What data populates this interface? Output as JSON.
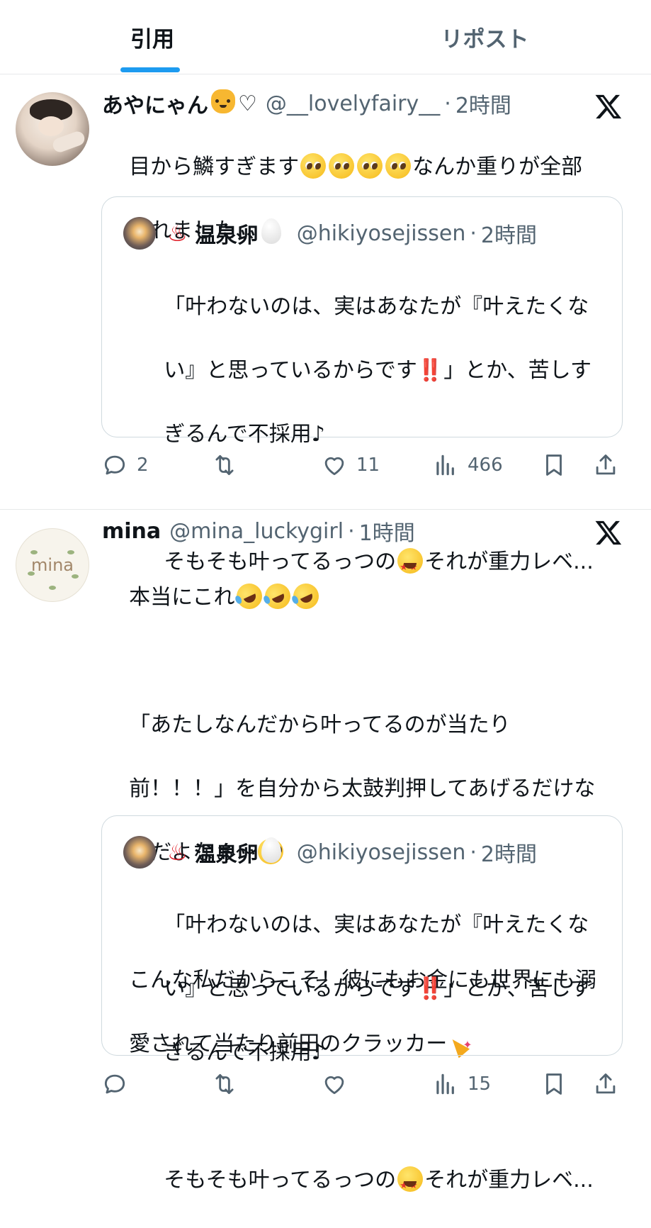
{
  "tabs": [
    {
      "label": "引用",
      "active": true
    },
    {
      "label": "リポスト",
      "active": false
    }
  ],
  "accent_color": "#1d9bf0",
  "tweets": [
    {
      "display_name": "あやにゃん",
      "name_suffix": "♡",
      "handle": "@__lovelyfairy__",
      "time": "2時間",
      "text_line1": "目から鱗すぎます",
      "text_line1_tail": "なんか重りが全部",
      "text_line2": "取れました、、",
      "quote": {
        "display_name": "温泉卵",
        "handle": "@hikiyosejissen",
        "time": "2時間",
        "p1_line1": "「叶わないのは、実はあなたが『叶えたくな",
        "p1_line2_a": "い』と思っているからです",
        "p1_line2_exclaim": "‼️",
        "p1_line2_b": "」とか、苦しす",
        "p1_line3": "ぎるんで不採用♪",
        "p2_a": "そもそも叶ってるっつの",
        "p2_b": "それが重力レベ..."
      },
      "actions": {
        "replies": "2",
        "reposts": "",
        "likes": "11",
        "views": "466"
      }
    },
    {
      "display_name": "mina",
      "handle": "@mina_luckygirl",
      "time": "1時間",
      "avatar_text": "mina",
      "line1": "本当にこれ",
      "para2_line1": "「あたしなんだから叶ってるのが当たり",
      "para2_line2": "前！！！」を自分から太鼓判押してあげるだけな",
      "para2_line3": "んだよなぁ〜",
      "para3_line1": "こんな私だからこそ！彼にもお金にも世界にも溺",
      "para3_line2": "愛されて当たり前田のクラッカー",
      "quote": {
        "display_name": "温泉卵",
        "handle": "@hikiyosejissen",
        "time": "2時間",
        "p1_line1": "「叶わないのは、実はあなたが『叶えたくな",
        "p1_line2_a": "い』と思っているからです",
        "p1_line2_exclaim": "‼️",
        "p1_line2_b": "」とか、苦しす",
        "p1_line3": "ぎるんで不採用♪",
        "p2_a": "そもそも叶ってるっつの",
        "p2_b": "それが重力レベ..."
      },
      "actions": {
        "replies": "",
        "reposts": "",
        "likes": "",
        "views": "15"
      }
    }
  ],
  "icons": [
    "reply-icon",
    "repost-icon",
    "like-icon",
    "views-icon",
    "bookmark-icon",
    "share-icon",
    "x-logo-icon"
  ]
}
